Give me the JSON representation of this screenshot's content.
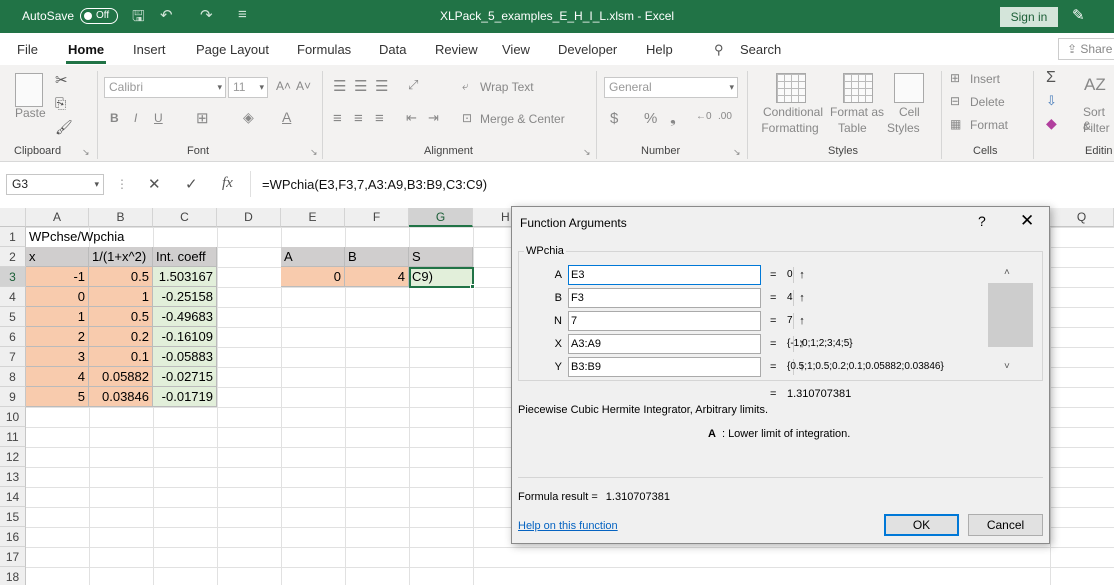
{
  "titlebar": {
    "autosave_label": "AutoSave",
    "autosave_state": "Off",
    "document_title": "XLPack_5_examples_E_H_I_L.xlsm  -  Excel",
    "signin_label": "Sign in"
  },
  "ribbon_tabs": [
    "File",
    "Home",
    "Insert",
    "Page Layout",
    "Formulas",
    "Data",
    "Review",
    "View",
    "Developer",
    "Help"
  ],
  "search_label": "Search",
  "share_label": "Share",
  "ribbon": {
    "clipboard": {
      "paste": "Paste",
      "label": "Clipboard"
    },
    "font": {
      "font_name": "Calibri",
      "font_size": "11",
      "label": "Font"
    },
    "alignment": {
      "wrap_text": "Wrap Text",
      "merge_center": "Merge & Center",
      "label": "Alignment"
    },
    "number": {
      "format": "General",
      "label": "Number"
    },
    "styles": {
      "conditional_1": "Conditional",
      "conditional_2": "Formatting",
      "format_as_1": "Format as",
      "format_as_2": "Table",
      "cell_1": "Cell",
      "cell_2": "Styles",
      "label": "Styles"
    },
    "cells": {
      "insert": "Insert",
      "delete": "Delete",
      "format": "Format",
      "label": "Cells"
    },
    "editing": {
      "sort_1": "Sort &",
      "sort_2": "Filter",
      "label": "Editin"
    }
  },
  "formula_bar": {
    "name_box": "G3",
    "fx_label": "fx",
    "formula": "=WPchia(E3,F3,7,A3:A9,B3:B9,C3:C9)"
  },
  "sheet": {
    "columns": [
      "A",
      "B",
      "C",
      "D",
      "E",
      "F",
      "G",
      "H",
      "Q"
    ],
    "rows": [
      "1",
      "2",
      "3",
      "4",
      "5",
      "6",
      "7",
      "8",
      "9",
      "10",
      "11",
      "12",
      "13",
      "14",
      "15",
      "16",
      "17",
      "18"
    ],
    "a1": "WPchse/Wpchia",
    "headers": {
      "a2": "x",
      "b2": "1/(1+x^2)",
      "c2": "Int. coeff",
      "e2": "A",
      "f2": "B",
      "g2": "S"
    },
    "x": [
      "-1",
      "0",
      "1",
      "2",
      "3",
      "4",
      "5"
    ],
    "y": [
      "0.5",
      "1",
      "0.5",
      "0.2",
      "0.1",
      "0.05882",
      "0.03846"
    ],
    "coeff": [
      "1.503167",
      "-0.25158",
      "-0.49683",
      "-0.16109",
      "-0.05883",
      "-0.02715",
      "-0.01719"
    ],
    "e3": "0",
    "f3": "4",
    "g3": "C9)"
  },
  "dialog": {
    "title": "Function Arguments",
    "help_glyph": "?",
    "close_glyph": "✕",
    "function_name": "WPchia",
    "args": [
      {
        "label": "A",
        "input": "E3",
        "value": "0"
      },
      {
        "label": "B",
        "input": "F3",
        "value": "4"
      },
      {
        "label": "N",
        "input": "7",
        "value": "7"
      },
      {
        "label": "X",
        "input": "A3:A9",
        "value": "{-1;0;1;2;3;4;5}"
      },
      {
        "label": "Y",
        "input": "B3:B9",
        "value": "{0.5;1;0.5;0.2;0.1;0.05882;0.03846}"
      }
    ],
    "equals": "=",
    "result_value": "1.310707381",
    "description": "Piecewise Cubic Hermite Integrator, Arbitrary limits.",
    "arg_desc_name": "A",
    "arg_desc_text": ": Lower limit of integration.",
    "formula_result_label": "Formula result =",
    "formula_result_value": "1.310707381",
    "help_link": "Help on this function",
    "ok": "OK",
    "cancel": "Cancel"
  }
}
